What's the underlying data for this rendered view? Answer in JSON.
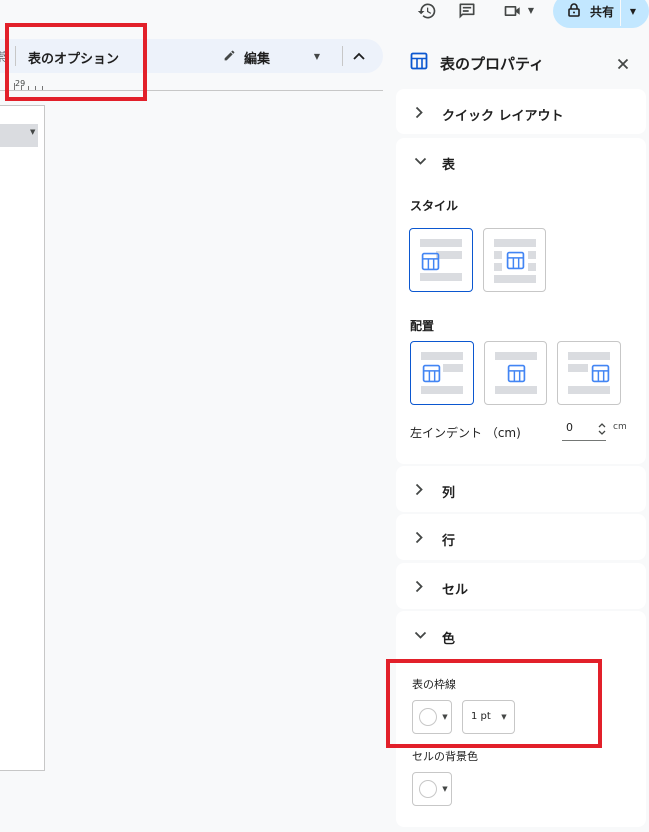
{
  "topbar": {
    "icons": [
      "history-icon",
      "comment-icon",
      "meet-icon",
      "meet-dropdown-icon"
    ],
    "share_label": "共有"
  },
  "toolbar": {
    "partial_text": "崇",
    "table_options_label": "表のオプション",
    "edit_label": "編集"
  },
  "ruler": {
    "number": "29"
  },
  "panel": {
    "title": "表のプロパティ",
    "quick_layout_label": "クイック レイアウト",
    "table_label": "表",
    "style_label": "スタイル",
    "alignment_label": "配置",
    "indent_label": "左インデント （cm)",
    "indent_value": "0",
    "indent_unit": "cm",
    "column_label": "列",
    "row_label": "行",
    "cell_label": "セル",
    "color_label": "色",
    "border_label": "表の枠線",
    "border_width": "1 pt",
    "cell_bg_label": "セルの背景色"
  }
}
